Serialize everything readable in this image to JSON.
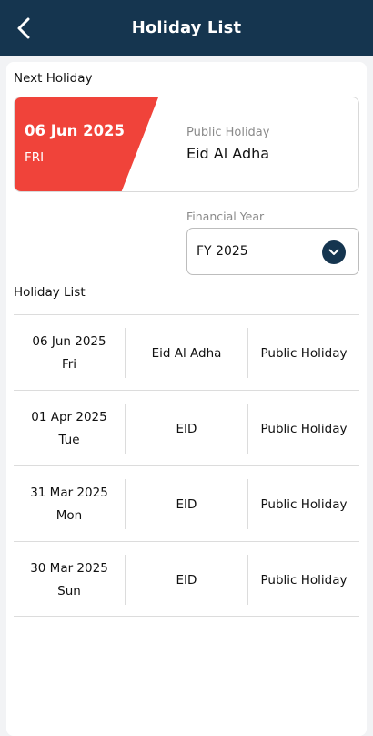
{
  "header": {
    "title": "Holiday List",
    "back_icon": "chevron-left-icon"
  },
  "next_holiday": {
    "section_label": "Next Holiday",
    "date": "06 Jun 2025",
    "day": "FRI",
    "type": "Public Holiday",
    "name": "Eid Al Adha",
    "accent_color": "#f0433a"
  },
  "financial_year": {
    "label": "Financial Year",
    "value": "FY 2025",
    "dropdown_icon": "chevron-down-icon"
  },
  "holiday_list": {
    "section_label": "Holiday List",
    "rows": [
      {
        "date": "06 Jun 2025",
        "day": "Fri",
        "name": "Eid Al Adha",
        "type": "Public Holiday"
      },
      {
        "date": "01 Apr 2025",
        "day": "Tue",
        "name": "EID",
        "type": "Public Holiday"
      },
      {
        "date": "31 Mar 2025",
        "day": "Mon",
        "name": "EID",
        "type": "Public Holiday"
      },
      {
        "date": "30 Mar 2025",
        "day": "Sun",
        "name": "EID",
        "type": "Public Holiday"
      }
    ]
  },
  "colors": {
    "header_bg": "#15354f",
    "page_bg": "#f2f3f5"
  }
}
